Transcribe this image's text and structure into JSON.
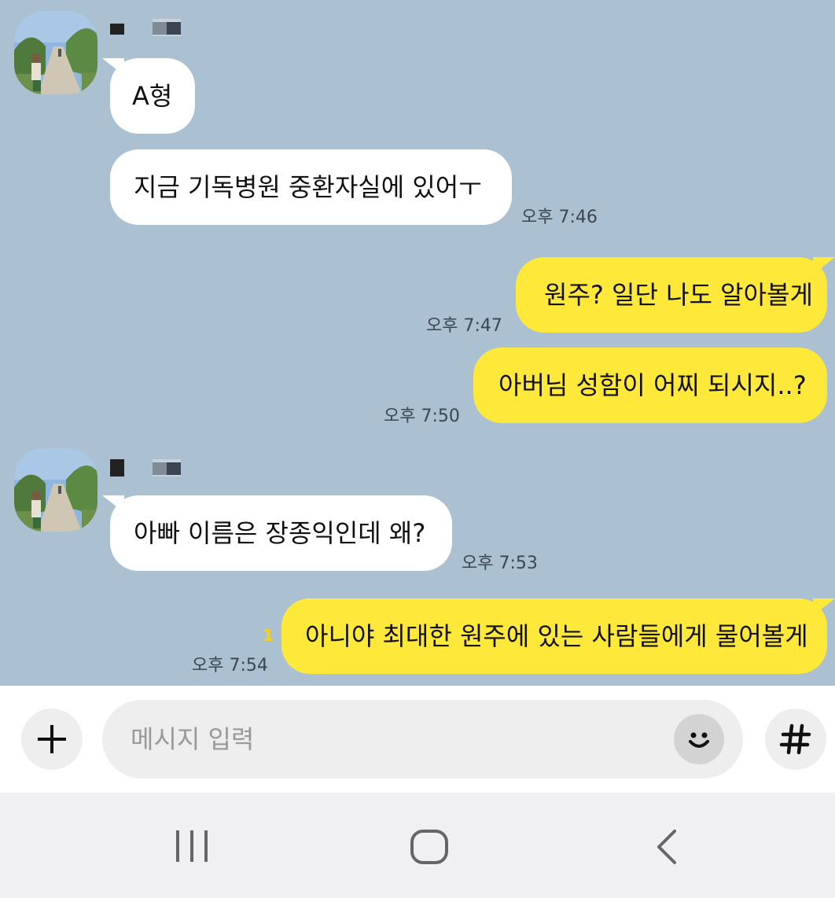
{
  "chat": {
    "messages": [
      {
        "text": "A형"
      },
      {
        "text": "지금 기독병원 중환자실에 있어ㅜ",
        "time": "오후 7:46"
      },
      {
        "text": "원주? 일단 나도 알아볼게",
        "time": "오후 7:47"
      },
      {
        "text": "아버님 성함이 어찌 되시지..?",
        "time": "오후 7:50"
      },
      {
        "text": "아빠 이름은 장종익인데 왜?",
        "time": "오후 7:53"
      },
      {
        "text": "아니야 최대한 원주에 있는 사람들에게 물어볼게",
        "time": "오후 7:54",
        "unread": "1"
      }
    ]
  },
  "input": {
    "placeholder": "메시지 입력",
    "add_icon": "plus-icon",
    "emoji_icon": "smiley-icon",
    "hashtag_icon": "hash-icon"
  },
  "navbar": {
    "icons": [
      "recent-apps-icon",
      "home-icon",
      "back-icon"
    ]
  },
  "colors": {
    "background": "#abc1d1",
    "incoming": "#ffffff",
    "outgoing": "#fee93a"
  }
}
